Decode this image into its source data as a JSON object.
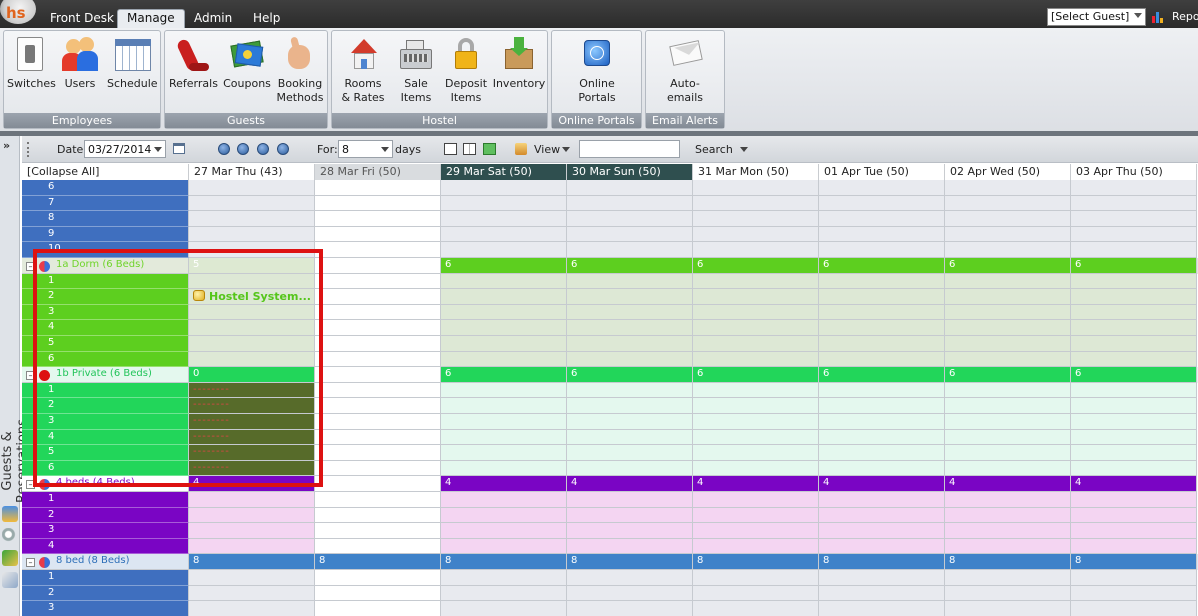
{
  "app": {
    "logo_text": "hs"
  },
  "menu": {
    "front_desk": "Front Desk",
    "manage": "Manage",
    "admin": "Admin",
    "help": "Help"
  },
  "guest_select": {
    "value": "[Select Guest]"
  },
  "report": {
    "label": "Repo"
  },
  "ribbon": {
    "groups": [
      {
        "label": "Employees",
        "buttons": [
          {
            "label": "Switches",
            "icon": "switch-icon"
          },
          {
            "label": "Users",
            "icon": "users-icon"
          },
          {
            "label": "Schedule",
            "icon": "calendar-icon"
          }
        ]
      },
      {
        "label": "Guests",
        "buttons": [
          {
            "label": "Referrals",
            "icon": "phone-icon"
          },
          {
            "label": "Coupons",
            "icon": "coupons-icon"
          },
          {
            "label": "Booking\nMethods",
            "icon": "hand-icon"
          }
        ]
      },
      {
        "label": "Hostel",
        "buttons": [
          {
            "label": "Rooms\n& Rates",
            "icon": "house-icon"
          },
          {
            "label": "Sale\nItems",
            "icon": "cash-register-icon"
          },
          {
            "label": "Deposit\nItems",
            "icon": "lock-icon"
          },
          {
            "label": "Inventory",
            "icon": "box-icon"
          }
        ]
      },
      {
        "label": "Online Portals",
        "buttons": [
          {
            "label": "Online\nPortals",
            "icon": "globe-icon"
          }
        ]
      },
      {
        "label": "Email Alerts",
        "buttons": [
          {
            "label": "Auto-\nemails",
            "icon": "envelope-icon"
          }
        ]
      }
    ]
  },
  "toolbar": {
    "date_label": "Date:",
    "date_value": "03/27/2014",
    "for_label": "For:",
    "for_value": "8",
    "days_label": "days",
    "view_label": "View",
    "search_value": "",
    "search_label": "Search"
  },
  "sidebar": {
    "label": "Guests & Reservations"
  },
  "grid": {
    "collapse_label": "[Collapse All]",
    "days": [
      "27 Mar Thu (43)",
      "28 Mar Fri (50)",
      "29 Mar Sat (50)",
      "30 Mar Sun (50)",
      "31 Mar Mon (50)",
      "01 Apr Tue (50)",
      "02 Apr Wed (50)",
      "03 Apr Thu (50)"
    ],
    "rooms": [
      {
        "name": "",
        "beds": [
          "6",
          "7",
          "8",
          "9",
          "10"
        ],
        "counts": []
      },
      {
        "name": "1a Dorm (6 Beds)",
        "beds": [
          "1",
          "2",
          "3",
          "4",
          "5",
          "6"
        ],
        "counts": [
          "5",
          "",
          "6",
          "6",
          "6",
          "6",
          "6",
          "6"
        ],
        "booking": "Hostel  System..."
      },
      {
        "name": "1b Private (6 Beds)",
        "beds": [
          "1",
          "2",
          "3",
          "4",
          "5",
          "6"
        ],
        "counts": [
          "0",
          "",
          "6",
          "6",
          "6",
          "6",
          "6",
          "6"
        ],
        "blocked_text": "--------"
      },
      {
        "name": "4 beds (4 Beds)",
        "beds": [
          "1",
          "2",
          "3",
          "4"
        ],
        "counts": [
          "4",
          "",
          "4",
          "4",
          "4",
          "4",
          "4",
          "4"
        ]
      },
      {
        "name": "8 bed (8 Beds)",
        "beds": [
          "1",
          "2",
          "3"
        ],
        "counts": [
          "8",
          "8",
          "8",
          "8",
          "8",
          "8",
          "8",
          "8"
        ]
      }
    ]
  },
  "colors": {
    "accent_blue": "#3f6fbf",
    "dorm_green": "#5dcf1f",
    "private_green": "#22d65a",
    "purple": "#7a05c4",
    "highlight_red": "#d11111"
  }
}
